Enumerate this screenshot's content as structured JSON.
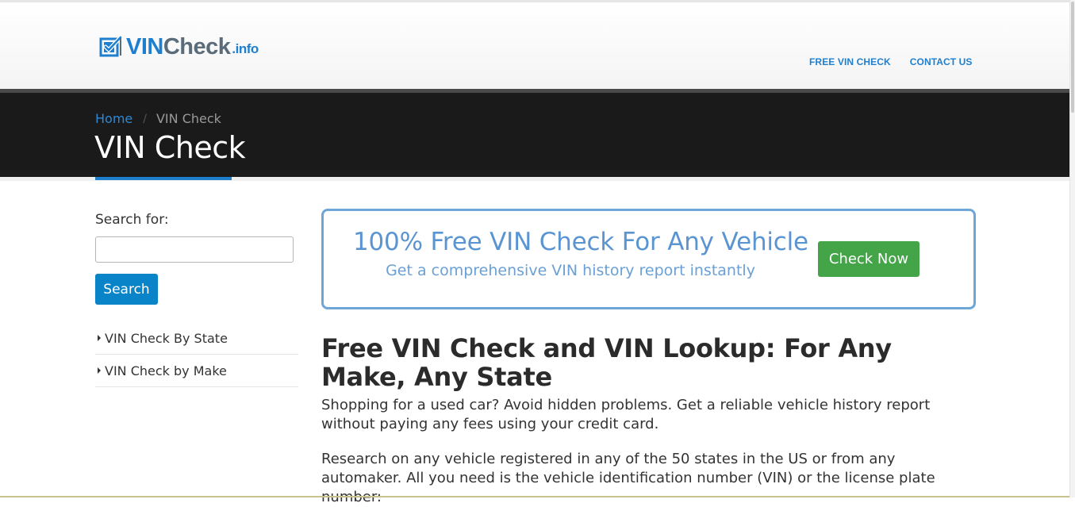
{
  "header": {
    "logo": {
      "vin": "VIN",
      "check": "Check",
      "info": ".info"
    },
    "nav": [
      {
        "label": "FREE VIN CHECK"
      },
      {
        "label": "CONTACT US"
      }
    ]
  },
  "breadcrumb": {
    "home": "Home",
    "separator": "/",
    "current": "VIN Check"
  },
  "page_title": "VIN Check",
  "sidebar": {
    "search_label": "Search for:",
    "search_value": "",
    "search_button": "Search",
    "links": [
      {
        "label": "VIN Check By State"
      },
      {
        "label": "VIN Check by Make"
      }
    ]
  },
  "promo": {
    "title": "100% Free VIN Check For Any Vehicle",
    "subtitle": "Get a comprehensive VIN history report instantly",
    "button": "Check Now"
  },
  "article": {
    "heading": "Free VIN Check and VIN Lookup: For Any Make, Any State",
    "paragraphs": [
      "Shopping for a used car? Avoid hidden problems. Get a reliable vehicle history report without paying any fees using your credit card.",
      "Research on any vehicle  registered in any of the 50 states in the US or from any automaker. All you need is the vehicle identification number (VIN) or the license plate number:"
    ]
  },
  "colors": {
    "brand_blue": "#1f7fcf",
    "header_band": "#1a1a1a",
    "search_button": "#0a84c8",
    "cta_green": "#43a548",
    "promo_border": "#6ea6d8"
  },
  "icons": {
    "logo": "checkbox-check-icon",
    "list_bullet": "caret-right-icon"
  }
}
